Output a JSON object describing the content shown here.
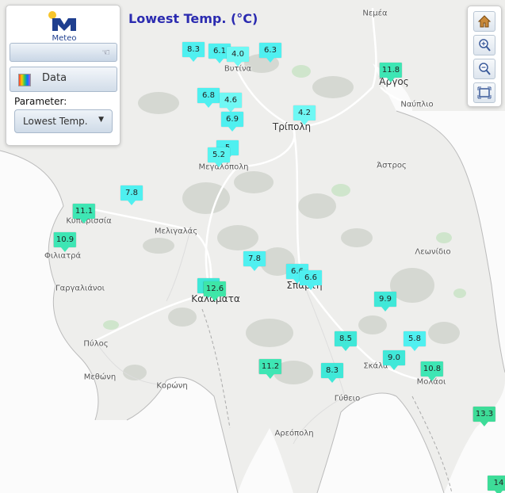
{
  "panel": {
    "logo_text": "Meteo",
    "data_button": "Data",
    "parameter_label": "Parameter:",
    "parameter_value": "Lowest Temp."
  },
  "map_title": "Lowest Temp. (°C)",
  "places": [
    {
      "name": "Νεμέα"
    },
    {
      "name": "Βυτίνα"
    },
    {
      "name": "Άργος",
      "city": true
    },
    {
      "name": "Ναύπλιο"
    },
    {
      "name": "Τρίπολη",
      "city": true
    },
    {
      "name": "Μεγαλόπολη"
    },
    {
      "name": "Άστρος"
    },
    {
      "name": "Κυπαρισσία"
    },
    {
      "name": "Μελιγαλάς"
    },
    {
      "name": "Φιλιατρά"
    },
    {
      "name": "Λεωνίδιο"
    },
    {
      "name": "Γαργαλιάνοι"
    },
    {
      "name": "Σπάρτη",
      "city": true
    },
    {
      "name": "Καλαμάτα",
      "city": true
    },
    {
      "name": "Πύλος"
    },
    {
      "name": "Μεθώνη"
    },
    {
      "name": "Κορώνη"
    },
    {
      "name": "Σκάλα"
    },
    {
      "name": "Μολάοι"
    },
    {
      "name": "Γύθειο"
    },
    {
      "name": "Αρεόπολη"
    }
  ],
  "stations": [
    {
      "value": "8.3",
      "color": "#4ff0f0"
    },
    {
      "value": "6.1",
      "color": "#4ff0f0"
    },
    {
      "value": "4.0",
      "color": "#6ff8f4"
    },
    {
      "value": "6.3",
      "color": "#4ff0f0"
    },
    {
      "value": "11.8",
      "color": "#3ee6b4"
    },
    {
      "value": "6.8",
      "color": "#4ff0f0"
    },
    {
      "value": "4.6",
      "color": "#6ff8f4"
    },
    {
      "value": "6.9",
      "color": "#4ff0f0"
    },
    {
      "value": "4.2",
      "color": "#6ff8f4"
    },
    {
      "value": "5",
      "color": "#4ff0f0"
    },
    {
      "value": "5.2",
      "color": "#5af4f0"
    },
    {
      "value": "7.8",
      "color": "#4ff0f0"
    },
    {
      "value": "11.1",
      "color": "#3ee6b4"
    },
    {
      "value": "10.9",
      "color": "#3ee6b4"
    },
    {
      "value": "7.8",
      "color": "#4ff0f0"
    },
    {
      "value": "6.6",
      "color": "#4ff0f0"
    },
    {
      "value": "6.6",
      "color": "#4ff0f0"
    },
    {
      "value": "9.9",
      "color": "#40e8d8"
    },
    {
      "value": "8",
      "color": "#40e8d8"
    },
    {
      "value": "12.6",
      "color": "#3ee6a8"
    },
    {
      "value": "8.5",
      "color": "#40e8d8"
    },
    {
      "value": "5.8",
      "color": "#4ff0f0"
    },
    {
      "value": "9.0",
      "color": "#40e8d8"
    },
    {
      "value": "11.2",
      "color": "#3ee6b4"
    },
    {
      "value": "8.3",
      "color": "#40e8d8"
    },
    {
      "value": "10.8",
      "color": "#3ee6b4"
    },
    {
      "value": "13.3",
      "color": "#3ddc98"
    },
    {
      "value": "14",
      "color": "#3ddc98"
    }
  ]
}
